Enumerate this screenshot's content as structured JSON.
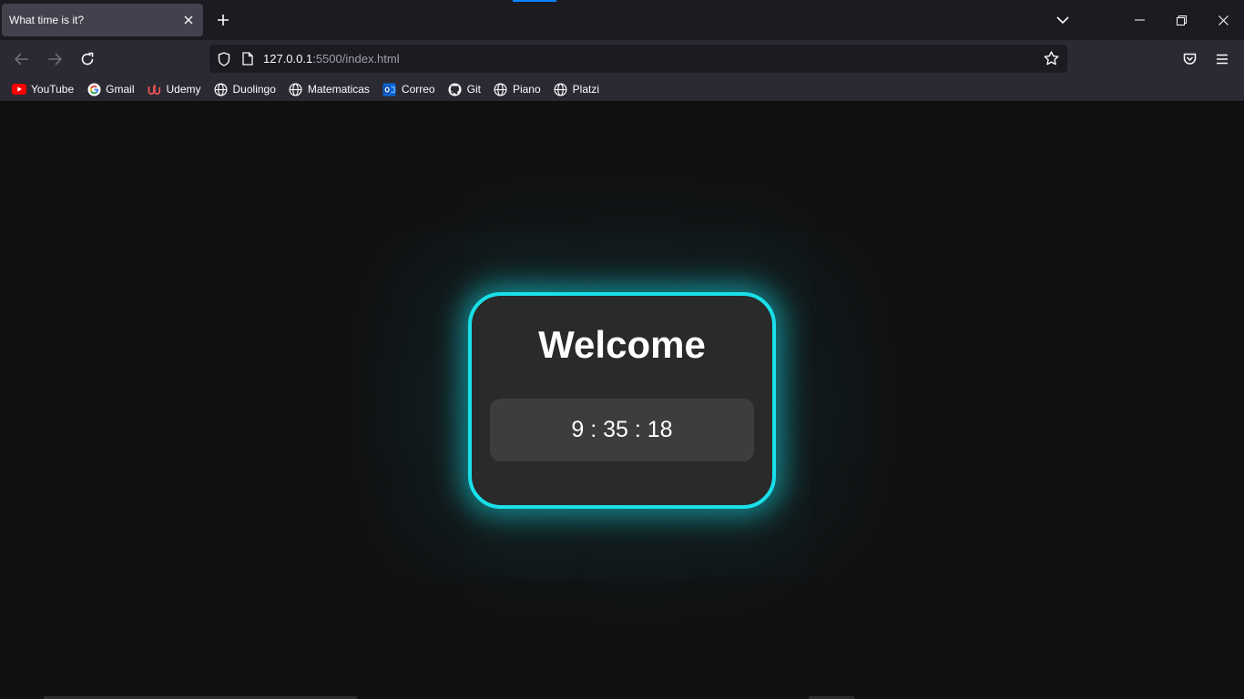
{
  "colors": {
    "accent_glow": "#19e0ea",
    "tab_active": "#42414d",
    "chrome": "#2b2a33",
    "page_bg": "#111112"
  },
  "tab": {
    "title": "What time is it?"
  },
  "toolbar": {
    "url_host": "127.0.0.1",
    "url_rest": ":5500/index.html"
  },
  "bookmarks": [
    {
      "label": "YouTube",
      "icon": "youtube-icon"
    },
    {
      "label": "Gmail",
      "icon": "google-icon"
    },
    {
      "label": "Udemy",
      "icon": "udemy-icon"
    },
    {
      "label": "Duolingo",
      "icon": "globe-icon"
    },
    {
      "label": "Matematicas",
      "icon": "globe-icon"
    },
    {
      "label": "Correo",
      "icon": "outlook-icon"
    },
    {
      "label": "Git",
      "icon": "github-icon"
    },
    {
      "label": "Piano",
      "icon": "globe-icon"
    },
    {
      "label": "Platzi",
      "icon": "globe-icon"
    }
  ],
  "page": {
    "heading": "Welcome",
    "clock": "9 : 35 : 18"
  }
}
